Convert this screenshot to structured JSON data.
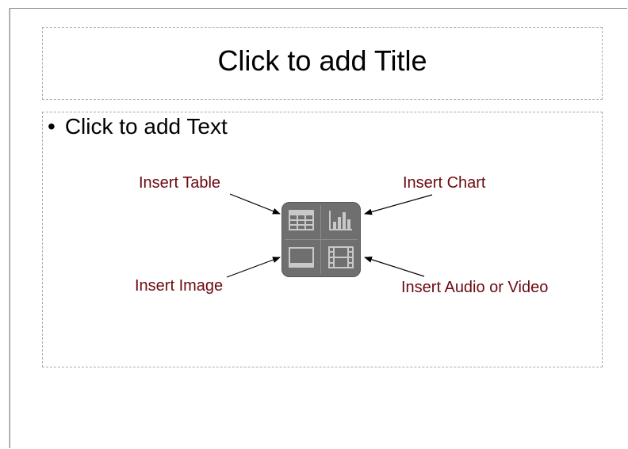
{
  "slide": {
    "title_placeholder": "Click to add Title",
    "content_placeholder": "Click to add Text",
    "bullet": "•"
  },
  "callouts": {
    "insert_table": "Insert Table",
    "insert_chart": "Insert Chart",
    "insert_image": "Insert Image",
    "insert_audio_video": "Insert Audio or Video"
  },
  "icons": {
    "table": "table-icon",
    "chart": "chart-icon",
    "image": "image-icon",
    "media": "film-icon"
  },
  "colors": {
    "callout_text": "#6b0a10",
    "panel": "#6f6f6f",
    "icon": "#c9c9c9",
    "placeholder_border": "#a9a9a9"
  }
}
